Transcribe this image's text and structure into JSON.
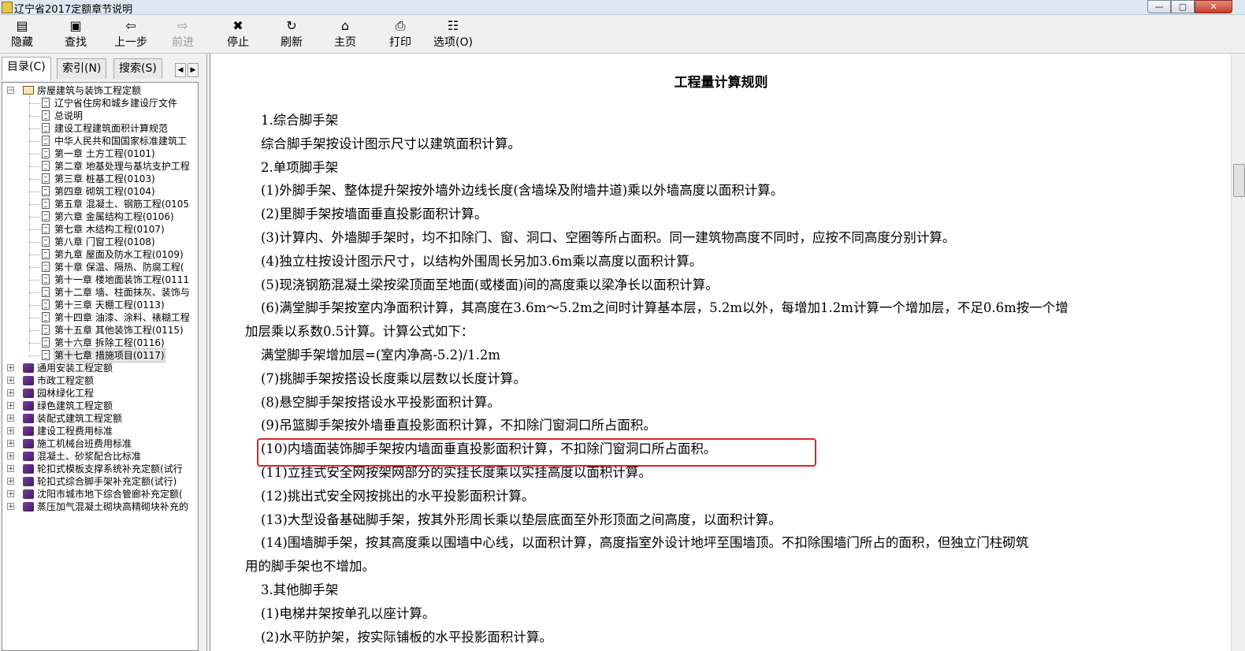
{
  "window": {
    "title": "辽宁省2017定额章节说明",
    "controls": {
      "minimize": "—",
      "maximize": "▢",
      "close": "✕"
    }
  },
  "toolbar": {
    "items": [
      {
        "label": "隐藏",
        "icon": "hide-icon"
      },
      {
        "label": "查找",
        "icon": "find-icon"
      },
      {
        "label": "上一步",
        "icon": "back-arrow-icon"
      },
      {
        "label": "前进",
        "icon": "forward-arrow-icon",
        "disabled": true
      },
      {
        "label": "停止",
        "icon": "stop-icon"
      },
      {
        "label": "刷新",
        "icon": "refresh-icon"
      },
      {
        "label": "主页",
        "icon": "home-icon"
      },
      {
        "label": "打印",
        "icon": "print-icon"
      },
      {
        "label": "选项(O)",
        "icon": "options-icon"
      }
    ]
  },
  "tabs": [
    {
      "label": "目录(C)",
      "active": true
    },
    {
      "label": "索引(N)",
      "active": false
    },
    {
      "label": "搜索(S)",
      "active": false
    }
  ],
  "tree": {
    "root": "房屋建筑与装饰工程定额",
    "children": [
      "辽宁省住房和城乡建设厅文件",
      "总说明",
      "建设工程建筑面积计算规范",
      "中华人民共和国国家标准建筑工",
      "第一章 土方工程(0101)",
      "第二章 地基处理与基坑支护工程",
      "第三章 桩基工程(0103)",
      "第四章 砌筑工程(0104)",
      "第五章 混凝土、钢筋工程(0105",
      "第六章 金属结构工程(0106)",
      "第七章 木结构工程(0107)",
      "第八章 门窗工程(0108)",
      "第九章 屋面及防水工程(0109)",
      "第十章 保温、隔热、防腐工程(",
      "第十一章 楼地面装饰工程(0111",
      "第十二章 墙、柱面抹灰、装饰与",
      "第十三章 天棚工程(0113)",
      "第十四章 油漆、涂料、裱糊工程",
      "第十五章 其他装饰工程(0115)",
      "第十六章 拆除工程(0116)",
      "第十七章 措施项目(0117)"
    ],
    "other_books": [
      "通用安装工程定额",
      "市政工程定额",
      "园林绿化工程",
      "绿色建筑工程定额",
      "装配式建筑工程定额",
      "建设工程费用标准",
      "施工机械台班费用标准",
      "混凝土、砂浆配合比标准",
      "轮扣式模板支撑系统补充定额(试行",
      "轮扣式综合脚手架补充定额(试行)",
      "沈阳市城市地下综合管廊补充定额(",
      "蒸压加气混凝土砌块高精砌块补充的"
    ]
  },
  "document": {
    "title": "工程量计算规则",
    "lines": [
      "1.综合脚手架",
      "综合脚手架按设计图示尺寸以建筑面积计算。",
      "2.单项脚手架",
      "(1)外脚手架、整体提升架按外墙外边线长度(含墙垛及附墙井道)乘以外墙高度以面积计算。",
      "(2)里脚手架按墙面垂直投影面积计算。",
      "(3)计算内、外墙脚手架时，均不扣除门、窗、洞口、空圈等所占面积。同一建筑物高度不同时，应按不同高度分别计算。",
      "(4)独立柱按设计图示尺寸，以结构外围周长另加3.6m乘以高度以面积计算。",
      "(5)现浇钢筋混凝土梁按梁顶面至地面(或楼面)间的高度乘以梁净长以面积计算。",
      "(6)满堂脚手架按室内净面积计算，其高度在3.6m～5.2m之间时计算基本层，5.2m以外，每增加1.2m计算一个增加层，不足0.6m按一个增",
      "加层乘以系数0.5计算。计算公式如下：",
      "满堂脚手架增加层=(室内净高-5.2)/1.2m",
      "(7)挑脚手架按搭设长度乘以层数以长度计算。",
      "(8)悬空脚手架按搭设水平投影面积计算。",
      "(9)吊篮脚手架按外墙垂直投影面积计算，不扣除门窗洞口所占面积。",
      "(10)内墙面装饰脚手架按内墙面垂直投影面积计算，不扣除门窗洞口所占面积。",
      "(11)立挂式安全网按架网部分的实挂长度乘以实挂高度以面积计算。",
      "(12)挑出式安全网按挑出的水平投影面积计算。",
      "(13)大型设备基础脚手架，按其外形周长乘以垫层底面至外形顶面之间高度，以面积计算。",
      "(14)围墙脚手架，按其高度乘以围墙中心线，以面积计算，高度指室外设计地坪至围墙顶。不扣除围墙门所占的面积，但独立门柱砌筑",
      "用的脚手架也不增加。",
      "3.其他脚手架",
      "(1)电梯井架按单孔以座计算。",
      "(2)水平防护架，按实际铺板的水平投影面积计算。"
    ]
  },
  "colors": {
    "highlight": "#e02020"
  }
}
